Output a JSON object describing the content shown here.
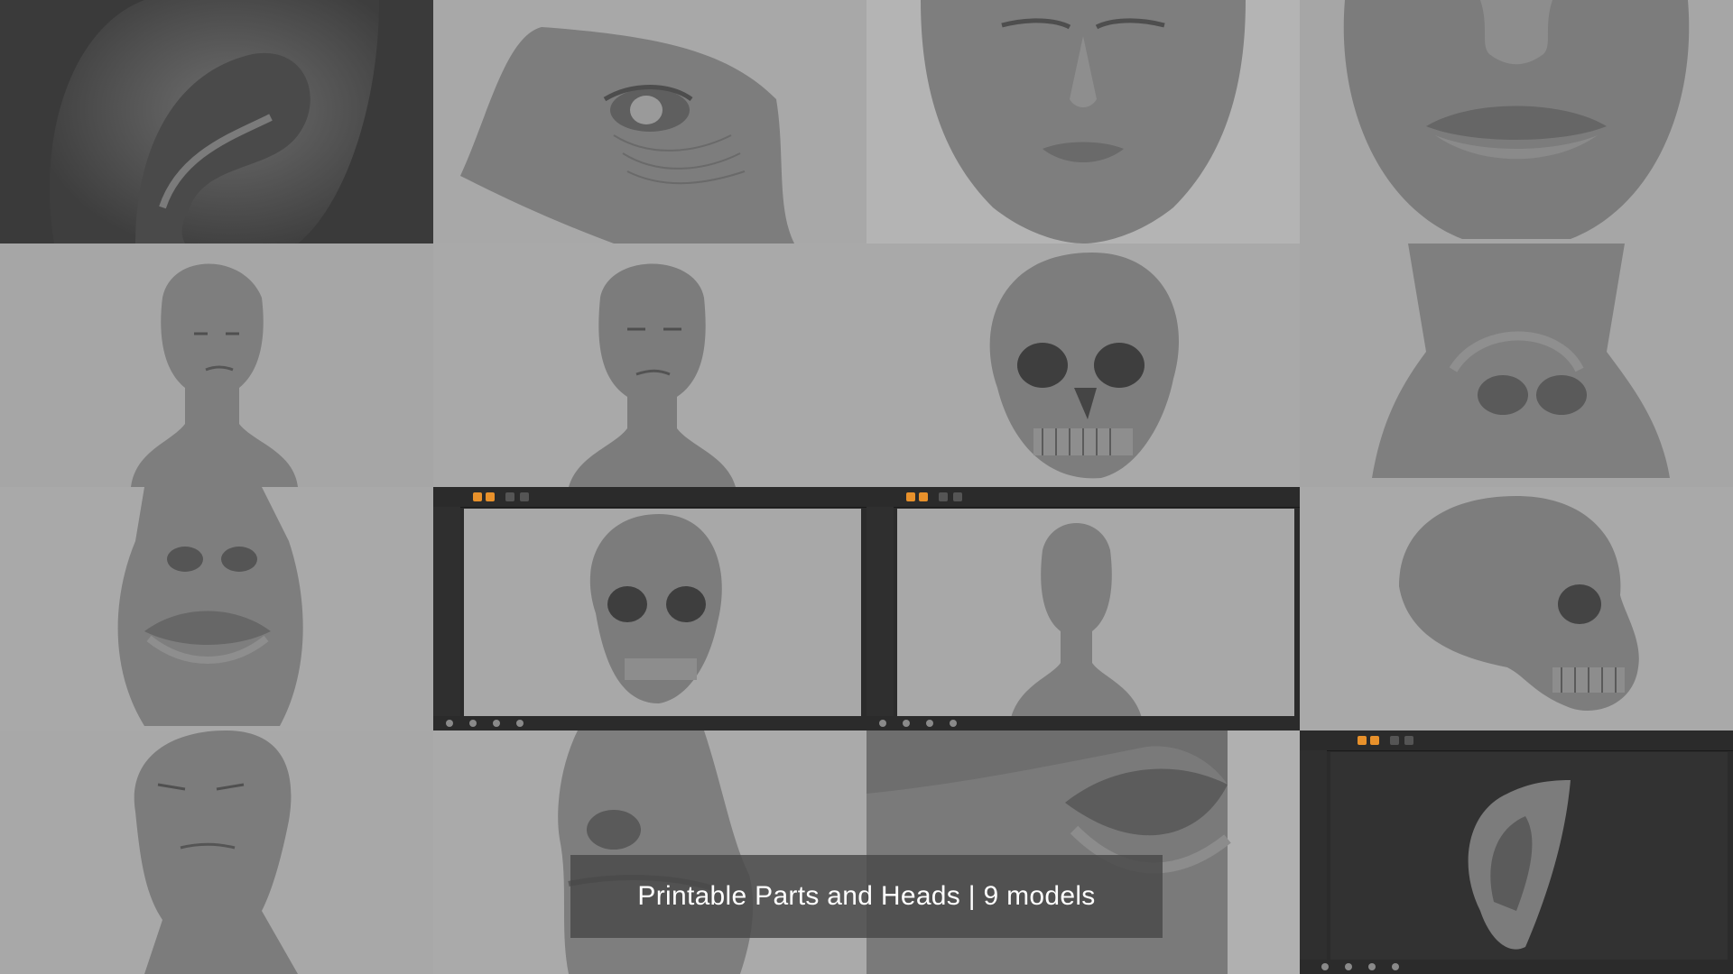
{
  "caption": {
    "text": "Printable Parts and Heads | 9 models"
  },
  "tiles": [
    {
      "name": "ear-closeup",
      "bg": "#3a3a3a"
    },
    {
      "name": "aged-eye-detail",
      "bg": "#a8a8a8"
    },
    {
      "name": "female-face-front",
      "bg": "#b4b4b4"
    },
    {
      "name": "mouth-chin-front",
      "bg": "#a6a6a6"
    },
    {
      "name": "female-bust-front",
      "bg": "#a6a6a6"
    },
    {
      "name": "male-bust-front",
      "bg": "#a9a9a9"
    },
    {
      "name": "skull-three-quarter",
      "bg": "#a9a9a9"
    },
    {
      "name": "nose-front",
      "bg": "#a6a6a6"
    },
    {
      "name": "nose-mouth-front",
      "bg": "#a9a9a9"
    },
    {
      "name": "zbrush-skull",
      "bg": "#2b2b2b"
    },
    {
      "name": "zbrush-female-bust",
      "bg": "#2b2b2b"
    },
    {
      "name": "skull-side",
      "bg": "#a9a9a9"
    },
    {
      "name": "male-head-tilted",
      "bg": "#a8a8a8"
    },
    {
      "name": "nose-mouth-side",
      "bg": "#aaaaaa"
    },
    {
      "name": "lips-closeup",
      "bg": "#8c8c8c"
    },
    {
      "name": "zbrush-ear",
      "bg": "#2b2b2b"
    }
  ]
}
